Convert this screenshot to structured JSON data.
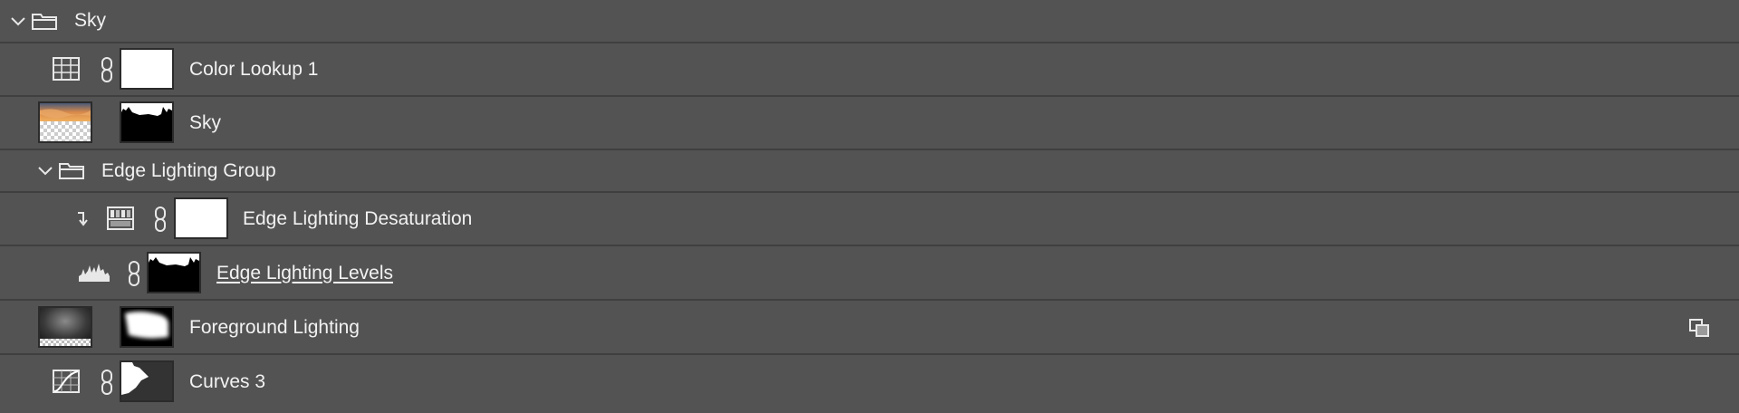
{
  "layers": {
    "rows": [
      {
        "name": "Sky",
        "kind": "group",
        "expanded": true,
        "icon": "folder-icon"
      },
      {
        "name": "Color Lookup 1",
        "kind": "adjustment",
        "icon": "color-lookup-grid-icon",
        "mask": "white"
      },
      {
        "name": "Sky",
        "kind": "pixel",
        "thumbnail": "sunset-sky-image",
        "mask": "black-with-tree-silhouette"
      },
      {
        "name": "Edge Lighting Group",
        "kind": "group",
        "expanded": true,
        "icon": "folder-icon"
      },
      {
        "name": "Edge Lighting Desaturation",
        "kind": "adjustment",
        "icon": "hue-saturation-icon",
        "mask": "white",
        "clipped": true
      },
      {
        "name": "Edge Lighting Levels",
        "kind": "adjustment",
        "icon": "levels-histogram-icon",
        "mask": "black-with-tree-silhouette",
        "selected_underline": true
      },
      {
        "name": "Foreground Lighting",
        "kind": "smart-object",
        "thumbnail": "dark-gradient-image",
        "mask": "soft-white-shape",
        "badge": "smart-object-icon"
      },
      {
        "name": "Curves 3",
        "kind": "adjustment",
        "icon": "curves-icon",
        "mask": "dark-with-white-shape"
      }
    ]
  },
  "colors": {
    "panel_bg": "#535353",
    "divider": "#3f3f3f",
    "text": "#f2f2f2"
  }
}
